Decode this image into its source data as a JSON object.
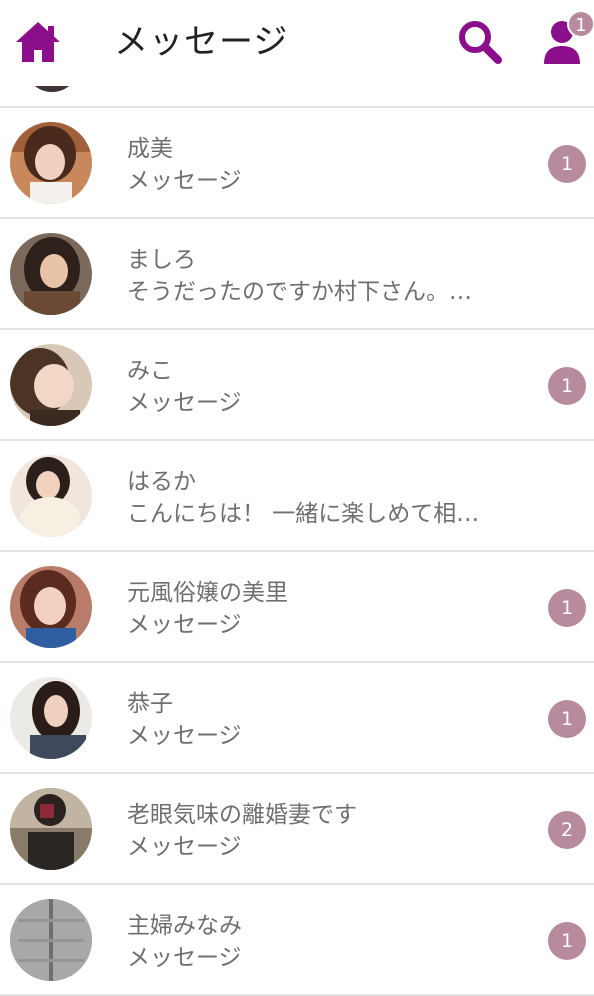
{
  "header": {
    "title": "メッセージ",
    "home_icon": "home-icon",
    "search_icon": "search-icon",
    "profile_icon": "user-icon",
    "profile_badge": "1",
    "accent_color": "#8b0e8b"
  },
  "badge_color": "#b88a9e",
  "conversations": [
    {
      "name": "成美",
      "preview": "メッセージ",
      "unread": "1"
    },
    {
      "name": "ましろ",
      "preview": "そうだったのですか村下さん。…",
      "unread": ""
    },
    {
      "name": "みこ",
      "preview": "メッセージ",
      "unread": "1"
    },
    {
      "name": "はるか",
      "preview": "こんにちは！ 一緒に楽しめて相…",
      "unread": ""
    },
    {
      "name": "元風俗嬢の美里",
      "preview": "メッセージ",
      "unread": "1"
    },
    {
      "name": "恭子",
      "preview": "メッセージ",
      "unread": "1"
    },
    {
      "name": "老眼気味の離婚妻です",
      "preview": "メッセージ",
      "unread": "2"
    },
    {
      "name": "主婦みなみ",
      "preview": "メッセージ",
      "unread": "1"
    }
  ]
}
